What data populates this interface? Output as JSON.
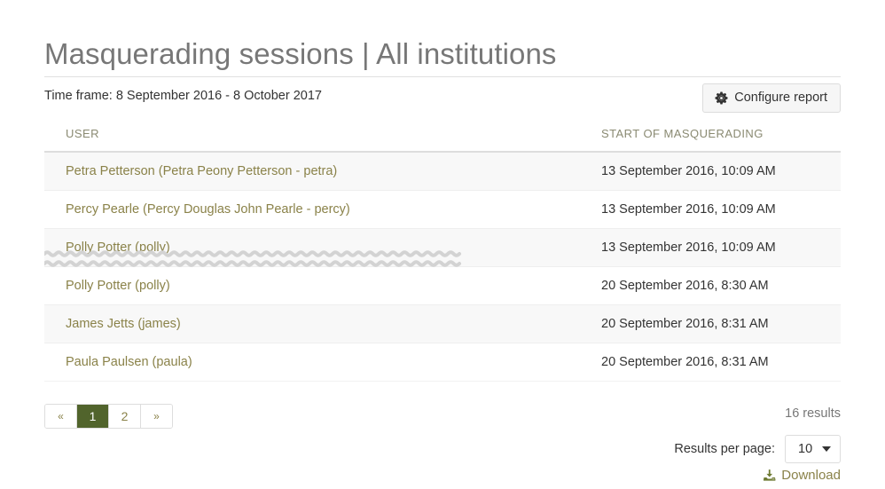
{
  "header": {
    "title": "Masquerading sessions | All institutions",
    "timeframe": "Time frame: 8 September 2016 - 8 October 2017",
    "configure_label": "Configure report",
    "configure_icon": "gear-icon"
  },
  "table": {
    "columns": [
      "USER",
      "START OF MASQUERADING"
    ],
    "rows": [
      {
        "user": "Petra Petterson (Petra Peony Petterson - petra)",
        "start": "13 September 2016, 10:09 AM"
      },
      {
        "user": "Percy Pearle (Percy Douglas John Pearle - percy)",
        "start": "13 September 2016, 10:09 AM"
      },
      {
        "user": "Polly Potter (polly)",
        "start": "13 September 2016, 10:09 AM"
      },
      {
        "user": "Polly Potter (polly)",
        "start": "20 September 2016, 8:30 AM"
      },
      {
        "user": "James Jetts (james)",
        "start": "20 September 2016, 8:31 AM"
      },
      {
        "user": "Paula Paulsen (paula)",
        "start": "20 September 2016, 8:31 AM"
      }
    ]
  },
  "pagination": {
    "prev_label": "«",
    "next_label": "»",
    "pages": [
      "1",
      "2"
    ],
    "active_page": "1"
  },
  "footer": {
    "results_count": "16 results",
    "results_per_page_label": "Results per page:",
    "results_per_page_value": "10",
    "results_per_page_options": [
      "10"
    ],
    "download_label": "Download",
    "download_icon": "download-icon"
  },
  "colors": {
    "accent_link": "#8a8249",
    "active_page_bg": "#51642c",
    "title": "#777777",
    "column_header": "#8a8a72",
    "row_alt_bg": "#f8f8f8"
  }
}
